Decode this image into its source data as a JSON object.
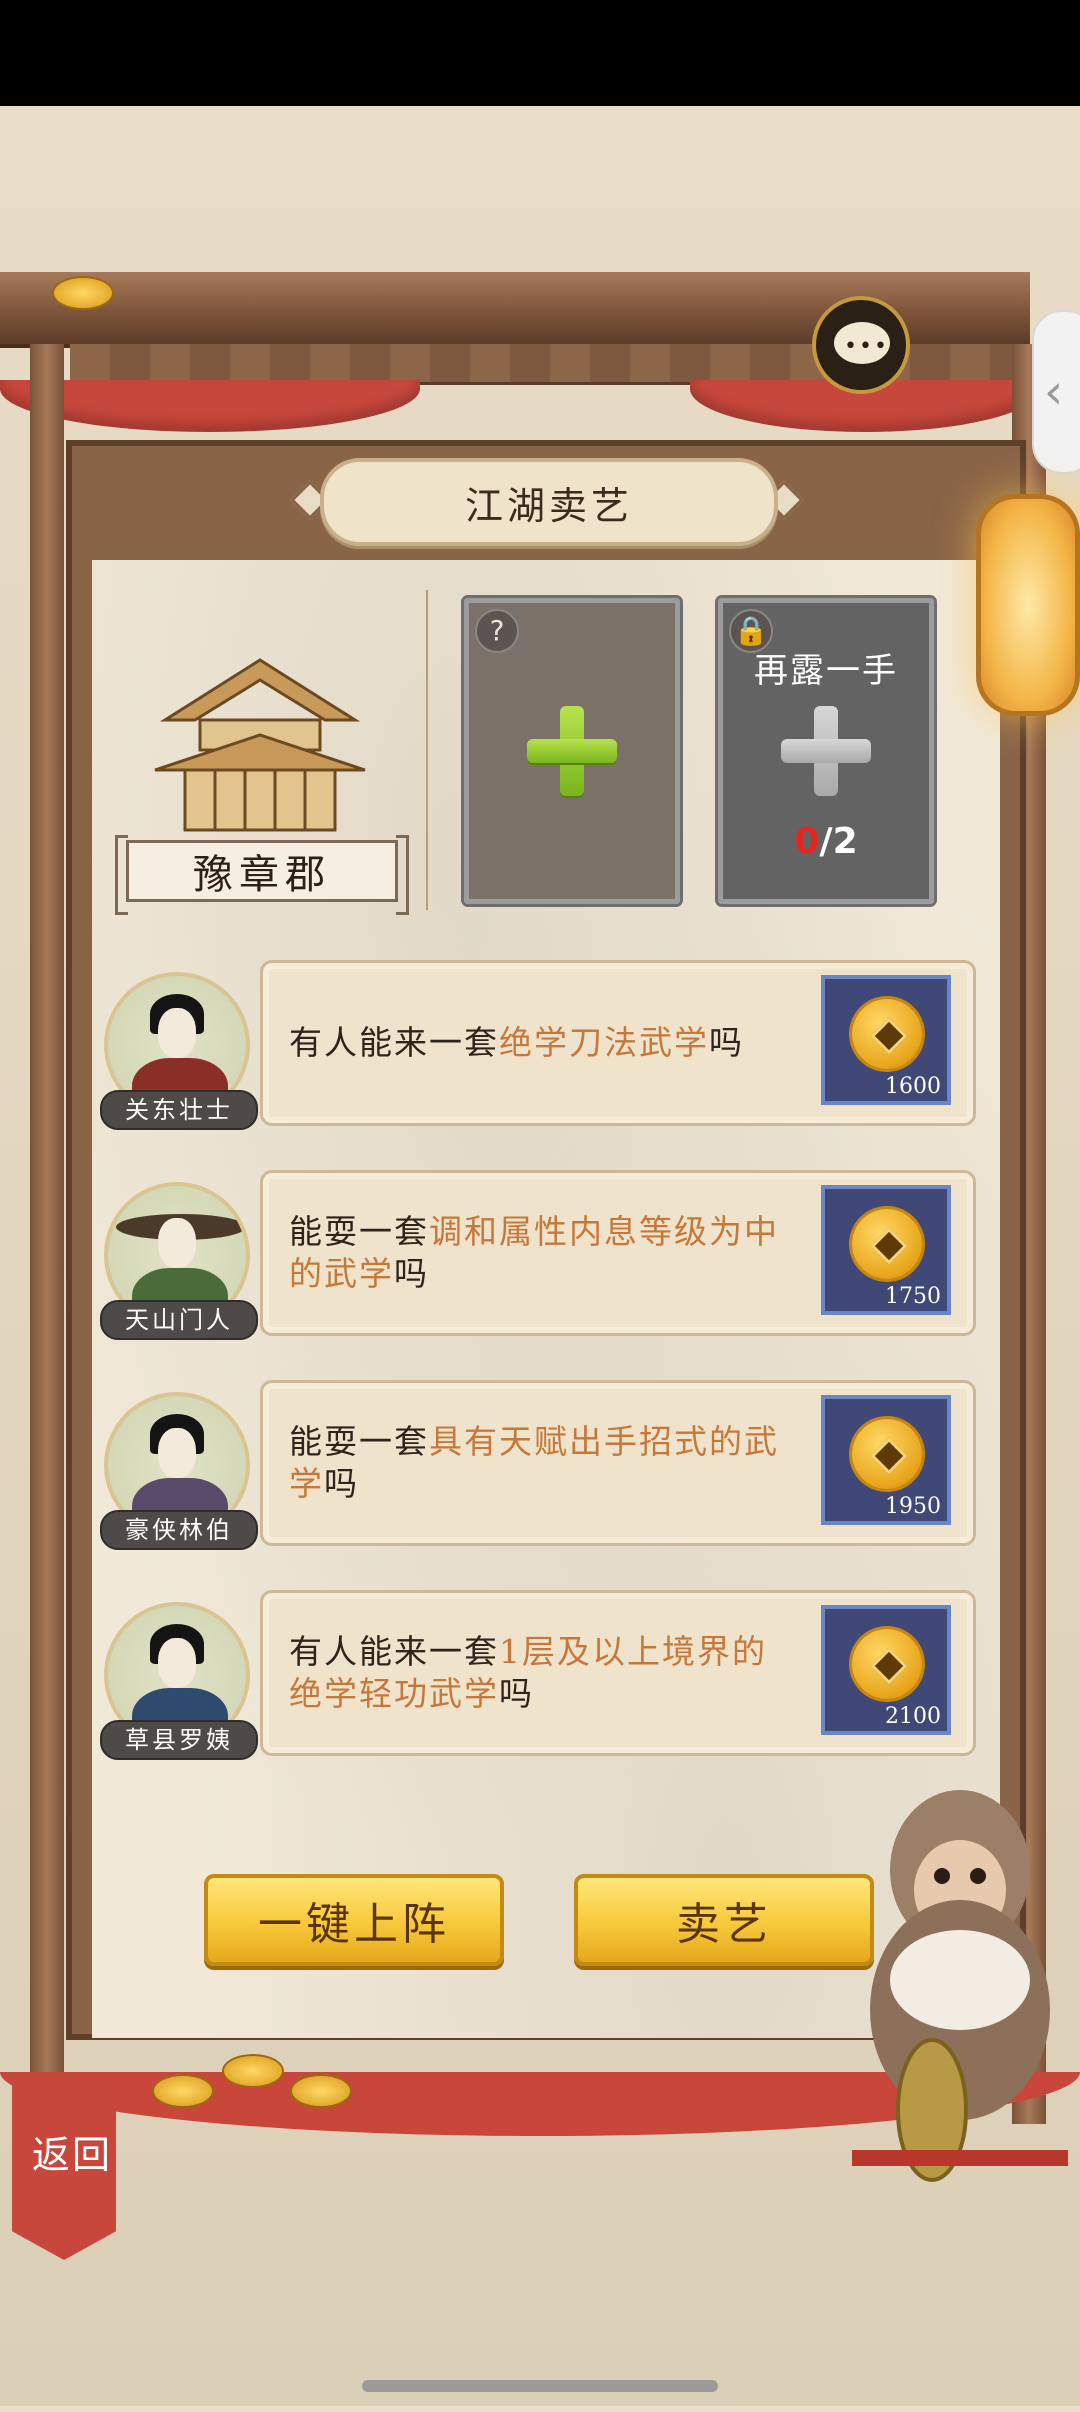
{
  "panel": {
    "title": "江湖卖艺"
  },
  "location": {
    "name": "豫章郡"
  },
  "slots": [
    {
      "corner_icon": "?",
      "icon": "plus-icon",
      "color": "#8cc63f"
    },
    {
      "title": "再露一手",
      "count_current": "0",
      "count_total": "/2",
      "icon": "plus-icon",
      "locked": true
    }
  ],
  "tasks": [
    {
      "npc": "关东壮士",
      "prefix": "有人能来一套",
      "highlight": "绝学刀法武学",
      "suffix": "吗",
      "reward": "1600"
    },
    {
      "npc": "天山门人",
      "prefix": "能耍一套",
      "highlight": "调和属性内息等级为中的武学",
      "suffix": "吗",
      "reward": "1750"
    },
    {
      "npc": "豪侠林伯",
      "prefix": "能耍一套",
      "highlight": "具有天赋出手招式的武学",
      "suffix": "吗",
      "reward": "1950"
    },
    {
      "npc": "草县罗姨",
      "prefix": "有人能来一套",
      "highlight": "1层及以上境界的绝学轻功武学",
      "suffix": "吗",
      "reward": "2100"
    }
  ],
  "buttons": {
    "auto_deploy": "一键上阵",
    "perform": "卖艺"
  },
  "nav": {
    "back": "返回"
  },
  "colors": {
    "highlight": "#c6783a",
    "button": "#f7c93a",
    "reward_bg": "#3f4876",
    "counter_red": "#e5261f"
  }
}
